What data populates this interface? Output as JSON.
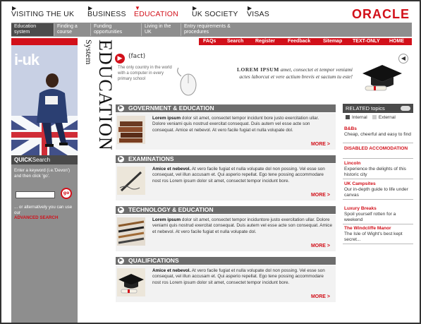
{
  "topnav": {
    "items": [
      {
        "label": "VISITING THE UK"
      },
      {
        "label": "BUSINESS"
      },
      {
        "label": "EDUCATION"
      },
      {
        "label": "UK SOCIETY"
      },
      {
        "label": "VISAS"
      }
    ],
    "brand": "ORACLE"
  },
  "subnav": {
    "items": [
      {
        "label": "Education system"
      },
      {
        "label": "Finding a course"
      },
      {
        "label": "Funding opportunities"
      },
      {
        "label": "Living in the UK"
      },
      {
        "label": "Entry requirements & procedures"
      }
    ]
  },
  "utility": {
    "items": [
      "FAQs",
      "Search",
      "Register",
      "Feedback",
      "Sitemap",
      "TEXT-ONLY",
      "HOME"
    ]
  },
  "hero": {
    "logo_text": "i-uk"
  },
  "vertical_label": {
    "title": "EDUCATION",
    "subtitle": "System"
  },
  "quicksearch": {
    "heading_strong": "QUICK",
    "heading_rest": "Search",
    "instructions": "Enter a keyword (i.e.'Devon') and then click 'go'.",
    "go_label": "go",
    "alt_text": "... or alternatively you can use our",
    "advanced_link": "ADVANCED SEARCH"
  },
  "fact": {
    "title": "(fact)",
    "text": "The only country in the world with a computer in every primary school"
  },
  "promo": {
    "lead": "LOREM IPSUM",
    "text": "amet, consectet et tempor veniami actes laborcut et vere actium brevis et sactum tu este!"
  },
  "sections": [
    {
      "title": "GOVERNMENT & EDUCATION",
      "lead": "Lorem ipsum",
      "text": "dolor sit amet, consectet tempor incidunt bore justo exercitation ullar. Dolore veniami quis nostrud exercitat consequat. Duis autem vel esse acte son consequat. Amice et nebevol. At vero facile fugiat et nulla volupate dol.",
      "more": "MORE >"
    },
    {
      "title": "EXAMINATIONS",
      "lead": "Amice et nebevol.",
      "text": "At vero facile fugiat et nulla volupate dol non possing. Vel esse son consequat, vel illun accusam et. Qui asperio repellat. Ego tene possing accommodare nost ros Lorem ipsum dolor sit amet, consectet tempor incidunt bore.",
      "more": "MORE >"
    },
    {
      "title": "TECHNOLOGY & EDUCATION",
      "lead": "Lorem ipsum",
      "text": "dolor sit amet, consectet tempor inciduntore justo exercitation ullar. Dolore veniami quis nostrud exercitat consequat. Duis autem vel esse acte son consequat. Amice et nebevol. At vero facile fugiat et nulla volupate dol.",
      "more": "MORE >"
    },
    {
      "title": "QUALIFICATIONS",
      "lead": "Amice et nebevol.",
      "text": "At vero facile fugiat et nulla volupate dol non possing. Vel esse son consequat, vel illun accusam et. Qui asperio repellat. Ego tene possing accommodare nost ros Lorem ipsum dolor sit amet, consectet tempor incidunt bore.",
      "more": "MORE >"
    }
  ],
  "related": {
    "heading": "RELATED topics",
    "legend_internal": "Internal",
    "legend_external": "External",
    "items": [
      {
        "title": "B&Bs",
        "desc": "Cheap, cheerful and easy to find"
      },
      {
        "title": "DISABLED ACCOMODATION",
        "desc": ""
      },
      {
        "title": "Lincoln",
        "desc": "Experience the delights of this historic city"
      },
      {
        "title": "UK Campsites",
        "desc": "Our in-depth guide to life under canvas"
      },
      {
        "title": "Luxury Breaks",
        "desc": "Spoil yourself rotten for a weekend"
      },
      {
        "title": "The Windcliffe Manor",
        "desc": "The Isle of Wight's best kept secret..."
      }
    ]
  },
  "colors": {
    "accent": "#d2101a",
    "bar_gray": "#8e8e8e",
    "dark_gray": "#4a4a4a"
  }
}
